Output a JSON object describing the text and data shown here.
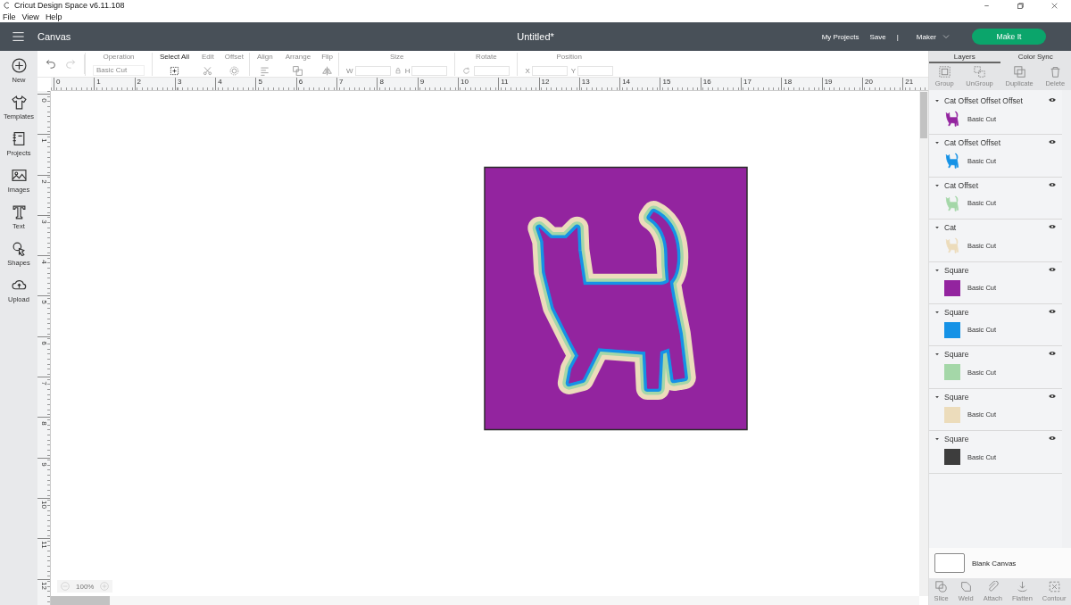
{
  "window": {
    "title": "Cricut Design Space  v6.11.108"
  },
  "menu": [
    "File",
    "View",
    "Help"
  ],
  "header": {
    "title": "Canvas",
    "document": "Untitled*",
    "links": [
      "My Projects",
      "Save"
    ],
    "separator": "|",
    "machine": "Maker",
    "primary": "Make It"
  },
  "sidebar": [
    {
      "kind": "new",
      "label": "New"
    },
    {
      "kind": "templates",
      "label": "Templates"
    },
    {
      "kind": "projects",
      "label": "Projects"
    },
    {
      "kind": "images",
      "label": "Images"
    },
    {
      "kind": "text",
      "label": "Text"
    },
    {
      "kind": "shapes",
      "label": "Shapes"
    },
    {
      "kind": "upload",
      "label": "Upload"
    }
  ],
  "history": [
    {
      "kind": "undo",
      "disabled": false
    },
    {
      "kind": "redo",
      "disabled": true
    }
  ],
  "toolbar": [
    {
      "kind": "operation",
      "label": "Operation",
      "value": "Basic Cut",
      "disabled": true
    },
    {
      "kind": "select-all",
      "label": "Select All",
      "disabled": false
    },
    {
      "kind": "edit",
      "label": "Edit",
      "disabled": true
    },
    {
      "kind": "offset",
      "label": "Offset",
      "disabled": true
    },
    {
      "kind": "align",
      "label": "Align",
      "disabled": true
    },
    {
      "kind": "arrange",
      "label": "Arrange",
      "disabled": true
    },
    {
      "kind": "flip",
      "label": "Flip",
      "disabled": true
    },
    {
      "kind": "size",
      "label": "Size",
      "fields": [
        "W",
        "H"
      ],
      "disabled": true
    },
    {
      "kind": "rotate",
      "label": "Rotate",
      "disabled": true
    },
    {
      "kind": "position",
      "label": "Position",
      "fields": [
        "X",
        "Y"
      ],
      "disabled": true
    }
  ],
  "ruler": {
    "horizontal": [
      "0",
      "1",
      "2",
      "3",
      "4",
      "5",
      "6",
      "7",
      "8",
      "9",
      "10",
      "11",
      "12",
      "13",
      "14",
      "15",
      "16",
      "17",
      "18",
      "19",
      "20",
      "21"
    ],
    "vertical": [
      "0",
      "1",
      "2",
      "3",
      "4",
      "5",
      "6",
      "7",
      "8",
      "9",
      "10",
      "11",
      "12"
    ]
  },
  "zoom": {
    "value": "100%"
  },
  "panel": {
    "tabs": [
      {
        "label": "Layers",
        "selected": true
      },
      {
        "label": "Color Sync",
        "selected": false
      }
    ],
    "actions": [
      {
        "kind": "group",
        "label": "Group",
        "disabled": true
      },
      {
        "kind": "ungroup",
        "label": "UnGroup",
        "disabled": true
      },
      {
        "kind": "duplicate",
        "label": "Duplicate",
        "disabled": true
      },
      {
        "kind": "delete",
        "label": "Delete",
        "disabled": true
      }
    ],
    "layers": [
      {
        "name": "Cat Offset Offset Offset",
        "kind": "cat",
        "operation": "Basic Cut",
        "color": "#93249f"
      },
      {
        "name": "Cat Offset Offset",
        "kind": "cat",
        "operation": "Basic Cut",
        "color": "#1592e6"
      },
      {
        "name": "Cat Offset",
        "kind": "cat",
        "operation": "Basic Cut",
        "color": "#a4d7a8"
      },
      {
        "name": "Cat",
        "kind": "cat",
        "operation": "Basic Cut",
        "color": "#ecdcbb"
      },
      {
        "name": "Square",
        "kind": "square",
        "operation": "Basic Cut",
        "color": "#93249f"
      },
      {
        "name": "Square",
        "kind": "square",
        "operation": "Basic Cut",
        "color": "#1592e6"
      },
      {
        "name": "Square",
        "kind": "square",
        "operation": "Basic Cut",
        "color": "#a4d7a8"
      },
      {
        "name": "Square",
        "kind": "square",
        "operation": "Basic Cut",
        "color": "#ecdcbb"
      },
      {
        "name": "Square",
        "kind": "square",
        "operation": "Basic Cut",
        "color": "#3d3d3d"
      }
    ],
    "canvas_label": "Blank Canvas",
    "bottom_actions": [
      {
        "kind": "slice",
        "label": "Slice",
        "disabled": true
      },
      {
        "kind": "weld",
        "label": "Weld",
        "disabled": true
      },
      {
        "kind": "attach",
        "label": "Attach",
        "disabled": true
      },
      {
        "kind": "flatten",
        "label": "Flatten",
        "disabled": true
      },
      {
        "kind": "contour",
        "label": "Contour",
        "disabled": true
      }
    ]
  }
}
